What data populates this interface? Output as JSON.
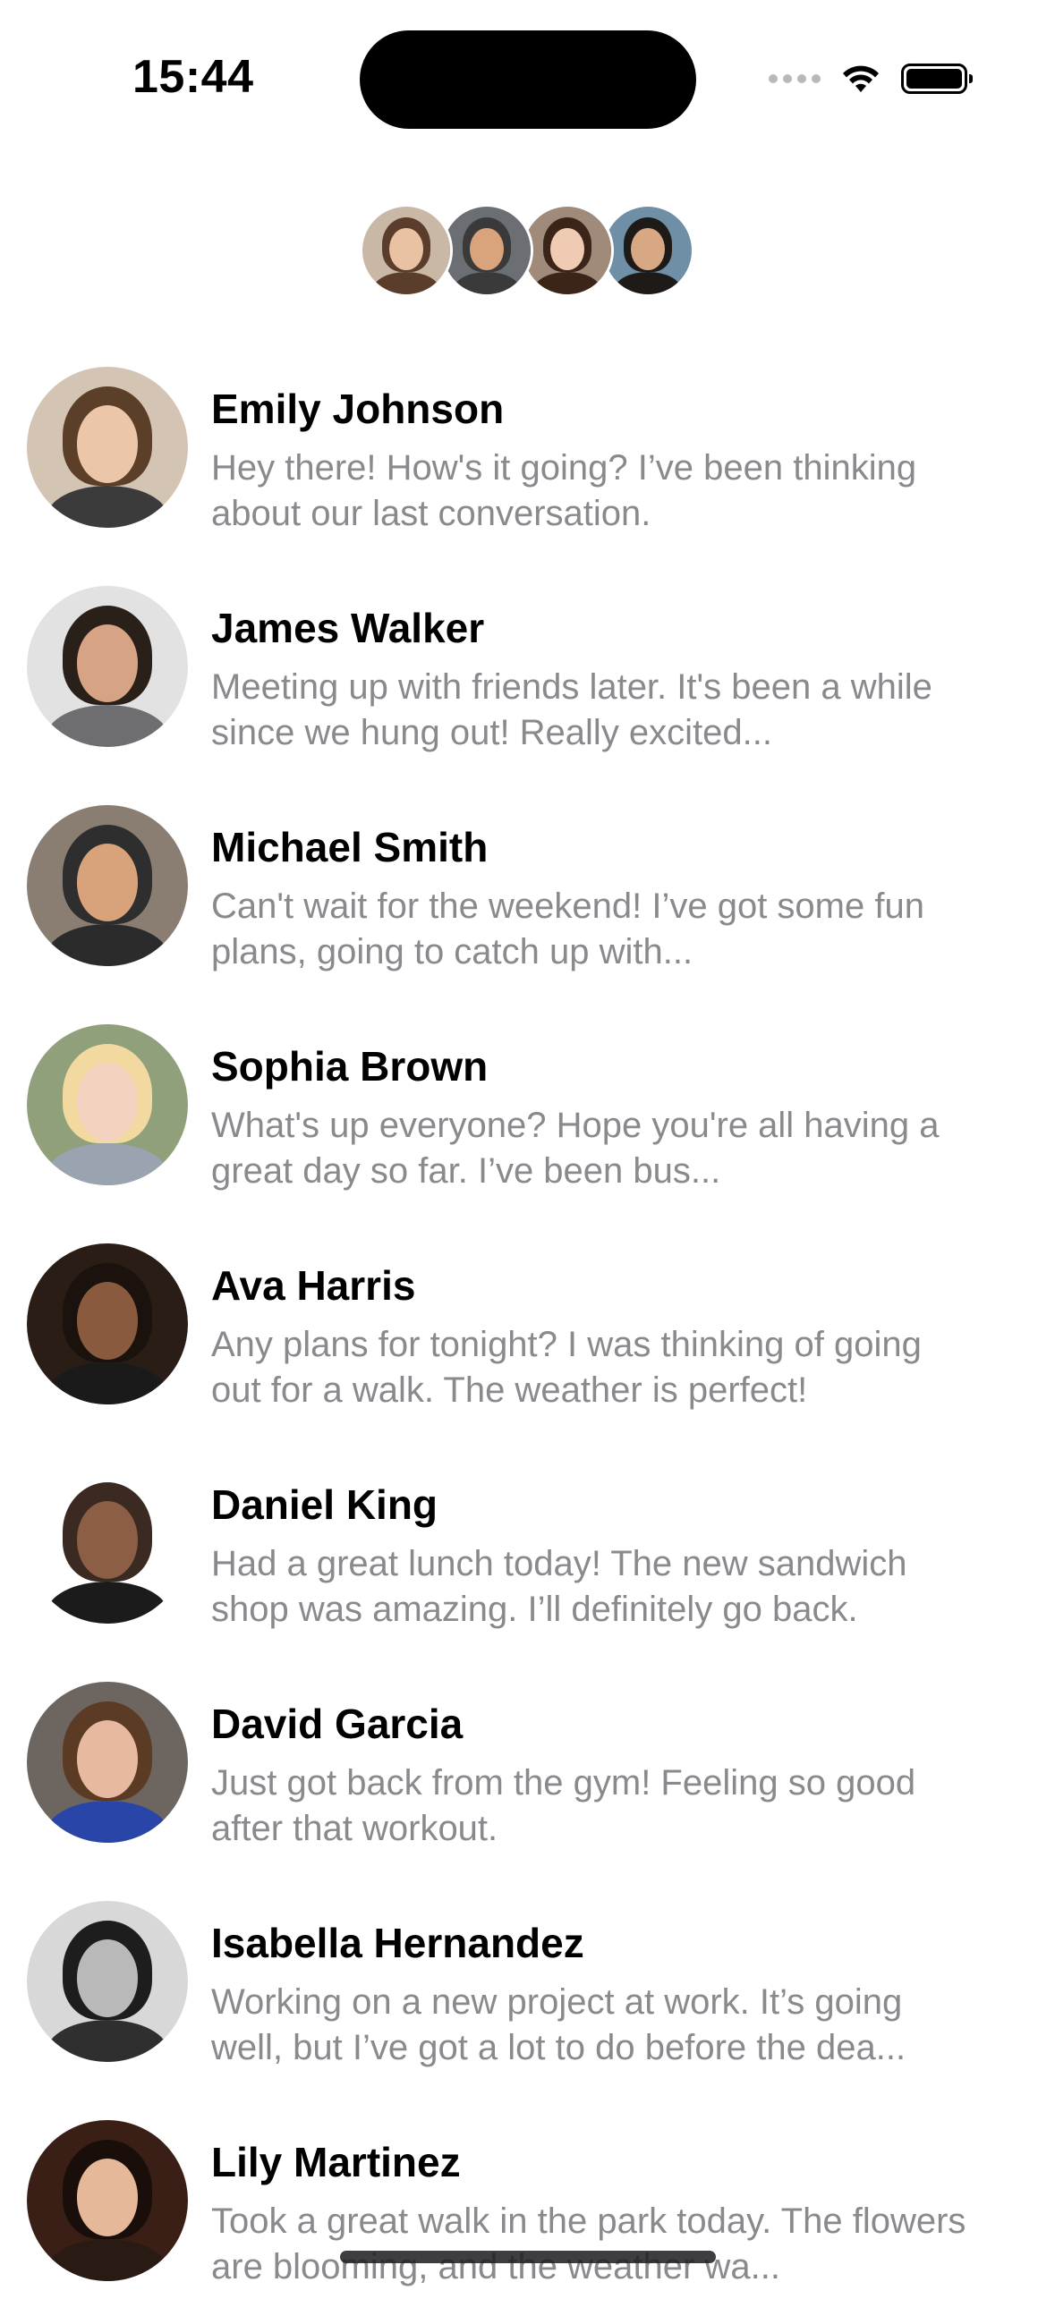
{
  "status_bar": {
    "time": "15:44",
    "signal_icon": "cellular-dots-icon",
    "wifi_icon": "wifi-icon",
    "battery_icon": "battery-icon"
  },
  "header": {
    "avatar_stack": [
      {
        "name": "avatar-emily",
        "skin": "#e9c2a4",
        "hair": "#5a3e2b",
        "bg": "#c9b8a5"
      },
      {
        "name": "avatar-michael",
        "skin": "#d9a37c",
        "hair": "#3a3a3a",
        "bg": "#6b6f74"
      },
      {
        "name": "avatar-woman-3",
        "skin": "#f0cbb4",
        "hair": "#3b2418",
        "bg": "#a08a7a"
      },
      {
        "name": "avatar-woman-4",
        "skin": "#d8a784",
        "hair": "#1e1a18",
        "bg": "#6f8fa6"
      }
    ]
  },
  "conversations": [
    {
      "name": "Emily Johnson",
      "preview": "Hey there! How's it going? I’ve been thinking about our last conversation.",
      "avatar": {
        "bg": "#d3c4b4",
        "hair": "#5b3f29",
        "skin": "#ecc6a8",
        "body": "#3b3b3b"
      }
    },
    {
      "name": "James Walker",
      "preview": "Meeting up with friends later. It's been a while since we hung out! Really excited...",
      "avatar": {
        "bg": "#e2e2e2",
        "hair": "#2a201a",
        "skin": "#d6a384",
        "body": "#6e6e70"
      }
    },
    {
      "name": "Michael Smith",
      "preview": "Can't wait for the weekend! I’ve got some fun plans, going to catch up with...",
      "avatar": {
        "bg": "#8a7d72",
        "hair": "#2e2e2e",
        "skin": "#d8a27b",
        "body": "#2b2b2b"
      }
    },
    {
      "name": "Sophia Brown",
      "preview": "What's up everyone? Hope you're all having a great day so far. I’ve been bus...",
      "avatar": {
        "bg": "#8fa07a",
        "hair": "#f1d9a0",
        "skin": "#f3d2c0",
        "body": "#9aa3b0"
      }
    },
    {
      "name": "Ava Harris",
      "preview": "Any plans for tonight? I was thinking of going out for a walk. The weather is perfect!",
      "avatar": {
        "bg": "#2a1d16",
        "hair": "#1b120d",
        "skin": "#8a5a3e",
        "body": "#1a1a1a"
      }
    },
    {
      "name": "Daniel King",
      "preview": "Had a great lunch today! The new sandwich shop was amazing. I’ll definitely go back.",
      "avatar": {
        "bg": "#ffffff",
        "hair": "#3a2a22",
        "skin": "#8b5e45",
        "body": "#1b1b1b"
      }
    },
    {
      "name": "David Garcia",
      "preview": "Just got back from the gym! Feeling so good after that workout.",
      "avatar": {
        "bg": "#6d6660",
        "hair": "#5b3b24",
        "skin": "#e7b9a0",
        "body": "#2a45a8"
      }
    },
    {
      "name": "Isabella Hernandez",
      "preview": "Working on a new project at work. It’s going well, but I’ve got a lot to do before the dea...",
      "avatar": {
        "bg": "#d8d8d8",
        "hair": "#1d1d1d",
        "skin": "#b9b9b9",
        "body": "#2f2f2f"
      }
    },
    {
      "name": "Lily Martinez",
      "preview": "Took a great walk in the park today. The flowers are blooming, and the weather wa...",
      "avatar": {
        "bg": "#3a1f17",
        "hair": "#1a0e0a",
        "skin": "#e6b89a",
        "body": "#2a1a14"
      }
    }
  ]
}
